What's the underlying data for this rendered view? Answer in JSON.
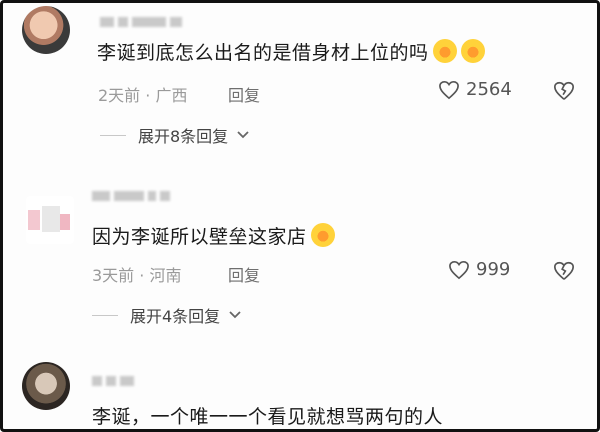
{
  "comments": [
    {
      "text": "李诞到底怎么出名的是借身材上位的吗",
      "time": "2天前",
      "region": "广西",
      "sep": "·",
      "reply_label": "回复",
      "likes": "2564",
      "expand_label": "展开8条回复",
      "emojis": [
        "laughing-emoji",
        "laughing-emoji"
      ]
    },
    {
      "text": "因为李诞所以壁垒这家店",
      "time": "3天前",
      "region": "河南",
      "sep": "·",
      "reply_label": "回复",
      "likes": "999",
      "expand_label": "展开4条回复",
      "emojis": [
        "laughing-emoji"
      ]
    },
    {
      "text": "李诞，一个唯一一个看见就想骂两句的人",
      "emojis": []
    }
  ],
  "colors": {
    "text": "#1a1a1a",
    "meta": "#9a9a9a",
    "emoji": "#ffd23a"
  }
}
